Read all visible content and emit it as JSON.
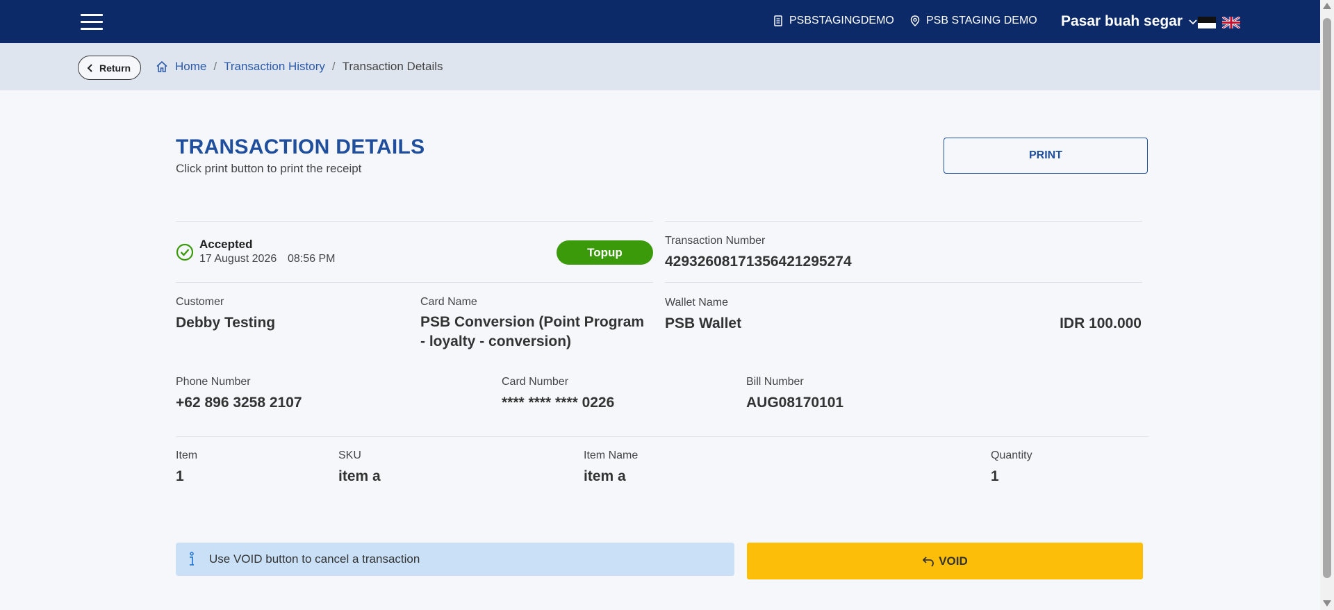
{
  "navbar": {
    "menu_icon": "hamburger-icon",
    "merchant_code": "PSBSTAGINGDEMO",
    "location": "PSB STAGING DEMO",
    "organization": "Pasar buah segar",
    "flags": [
      "indonesia-flag",
      "uk-flag"
    ],
    "bg_color": "#0c2a68"
  },
  "breadcrumb": {
    "return_label": "Return",
    "items": [
      "Home",
      "Transaction History",
      "Transaction Details"
    ]
  },
  "header": {
    "title": "TRANSACTION DETAILS",
    "subtitle": "Click print button to print the receipt",
    "print_label": "PRINT"
  },
  "transaction": {
    "status": "Accepted",
    "date": "17 August 2026",
    "time": "08:56 PM",
    "type": "Topup",
    "number_label": "Transaction Number",
    "number": "429326081713564212952​74",
    "customer_label": "Customer",
    "customer": "Debby Testing",
    "card_name_label": "Card Name",
    "card_name": "PSB Conversion (Point Program - loyalty - conversion)",
    "wallet_label": "Wallet Name",
    "wallet": "PSB Wallet",
    "amount": "IDR 100.000",
    "phone_label": "Phone Number",
    "phone": "+62 896 3258 2107",
    "card_number_label": "Card Number",
    "card_number": "**** **** **** 0226",
    "bill_label": "Bill Number",
    "bill": "AUG08170101"
  },
  "items_table": {
    "headers": [
      "Item",
      "SKU",
      "Item Name",
      "Quantity"
    ],
    "rows": [
      [
        "1",
        "item a",
        "item a",
        "1"
      ]
    ]
  },
  "footer": {
    "info_text": "Use VOID button to cancel a transaction",
    "void_label": "VOID"
  },
  "colors": {
    "accent": "#1f4e9c",
    "success": "#3a9a0a",
    "void": "#fcbe08",
    "info_bg": "#c9e0f6"
  }
}
